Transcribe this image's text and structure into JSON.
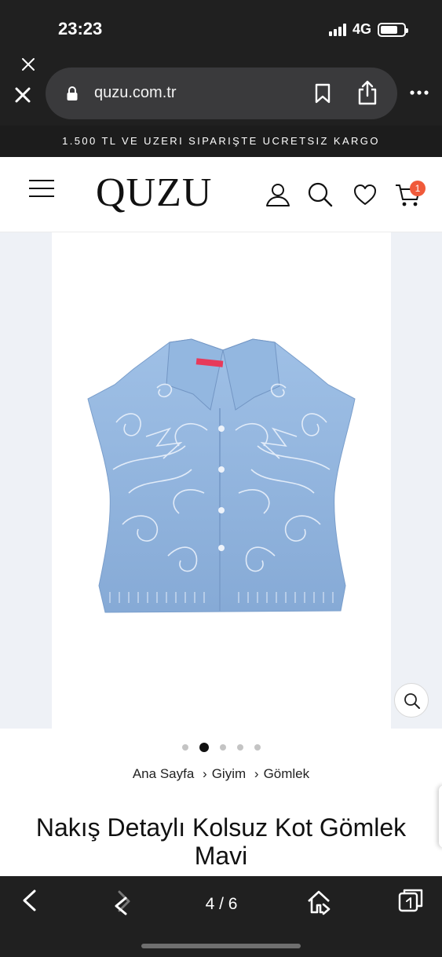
{
  "status_bar": {
    "time": "23:23",
    "network": "4G",
    "battery_level": 0.75
  },
  "browser": {
    "url": "quzu.com.tr"
  },
  "promo": {
    "text": "1.500 TL VE UZERI SIPARIŞTE UCRETSIZ KARGO"
  },
  "header": {
    "logo": "QUZU",
    "cart_count": "1"
  },
  "gallery": {
    "image_count": 5,
    "active_index": 1
  },
  "breadcrumb": {
    "items": [
      "Ana Sayfa",
      "Giyim",
      "Gömlek"
    ],
    "separator": "›"
  },
  "product": {
    "title": "Nakış Detaylı Kolsuz Kot Gömlek Mavi"
  },
  "toolbar": {
    "page_indicator": "4 / 6"
  },
  "colors": {
    "denim": "#8fb3dc",
    "badge": "#f05a3a",
    "chrome": "#202020"
  }
}
